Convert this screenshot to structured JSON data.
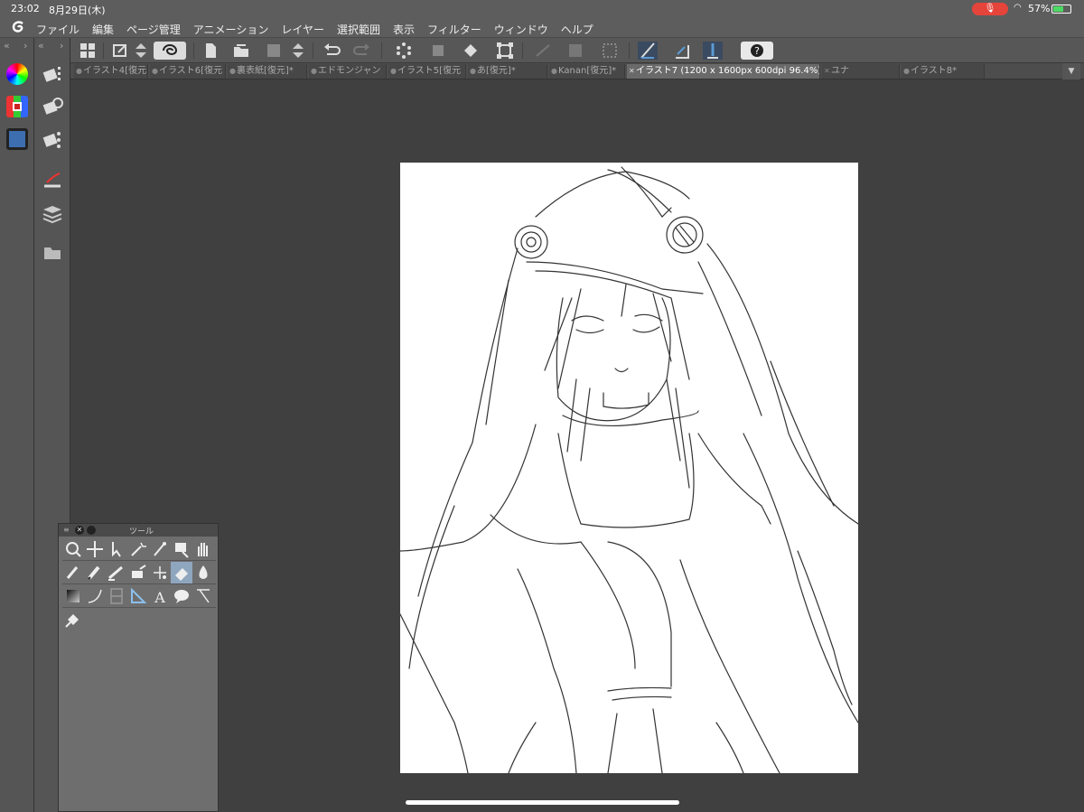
{
  "status_bar": {
    "time": "23:02",
    "date": "8月29日(木)",
    "battery": "57%"
  },
  "menubar": {
    "items": [
      "ファイル",
      "編集",
      "ページ管理",
      "アニメーション",
      "レイヤー",
      "選択範囲",
      "表示",
      "フィルター",
      "ウィンドウ",
      "ヘルプ"
    ]
  },
  "tabs": [
    {
      "label": "イラスト4[復元"
    },
    {
      "label": "イラスト6[復元"
    },
    {
      "label": "裏表紙[復元]*"
    },
    {
      "label": "エドモンジャン"
    },
    {
      "label": "イラスト5[復元"
    },
    {
      "label": "あ[復元]*"
    },
    {
      "label": "Kanan[復元]*"
    },
    {
      "label": "イラスト7 (1200 x 1600px 600dpi 96.4%)"
    },
    {
      "label": "ユナ"
    },
    {
      "label": "イラスト8*"
    }
  ],
  "tool_panel": {
    "title": "ツール"
  },
  "colors": {
    "canvas_bg": "#404040",
    "panel_bg": "#555555",
    "active_tab": "#6a6a6a",
    "active_tool": "#8fa6bf",
    "mic_indicator": "#e5443b"
  }
}
